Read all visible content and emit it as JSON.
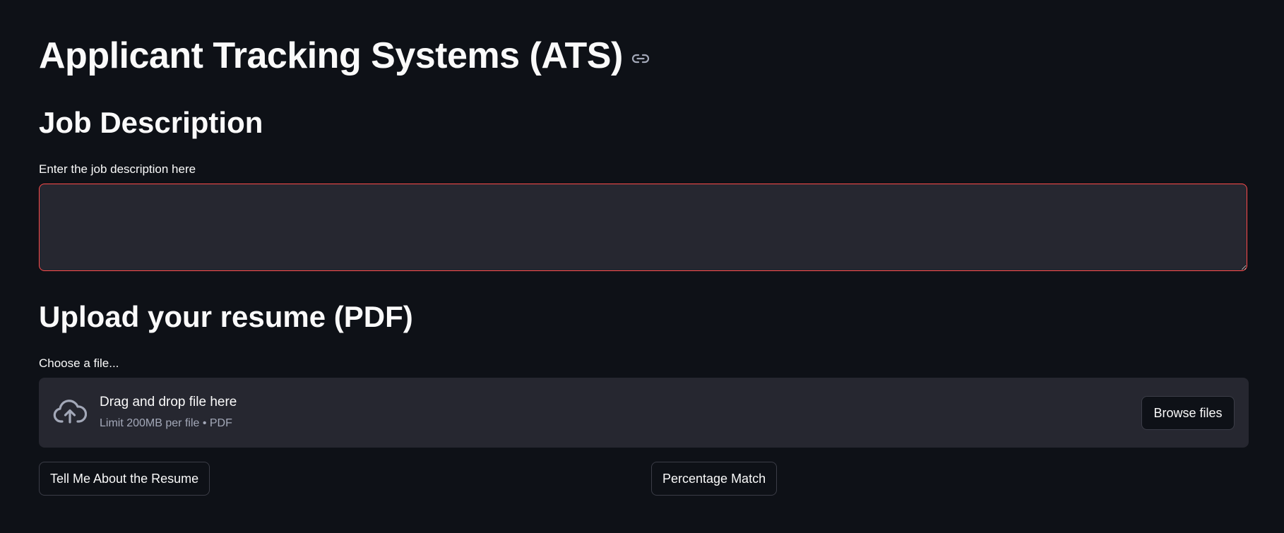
{
  "header": {
    "title": "Applicant Tracking Systems (ATS)",
    "anchor_icon": "link-icon"
  },
  "job_description": {
    "heading": "Job Description",
    "label": "Enter the job description here",
    "value": "",
    "border_color": "#ff4b4b"
  },
  "upload": {
    "heading": "Upload your resume (PDF)",
    "label": "Choose a file...",
    "dropzone_icon": "cloud-upload-icon",
    "dropzone_title": "Drag and drop file here",
    "dropzone_limit": "Limit 200MB per file • PDF",
    "browse_label": "Browse files"
  },
  "actions": {
    "tell_me_label": "Tell Me About the Resume",
    "percentage_label": "Percentage Match"
  },
  "colors": {
    "background": "#0e1117",
    "input_background": "#262730",
    "accent": "#ff4b4b",
    "text": "#fafafa",
    "muted_text": "#a3a8b8"
  }
}
